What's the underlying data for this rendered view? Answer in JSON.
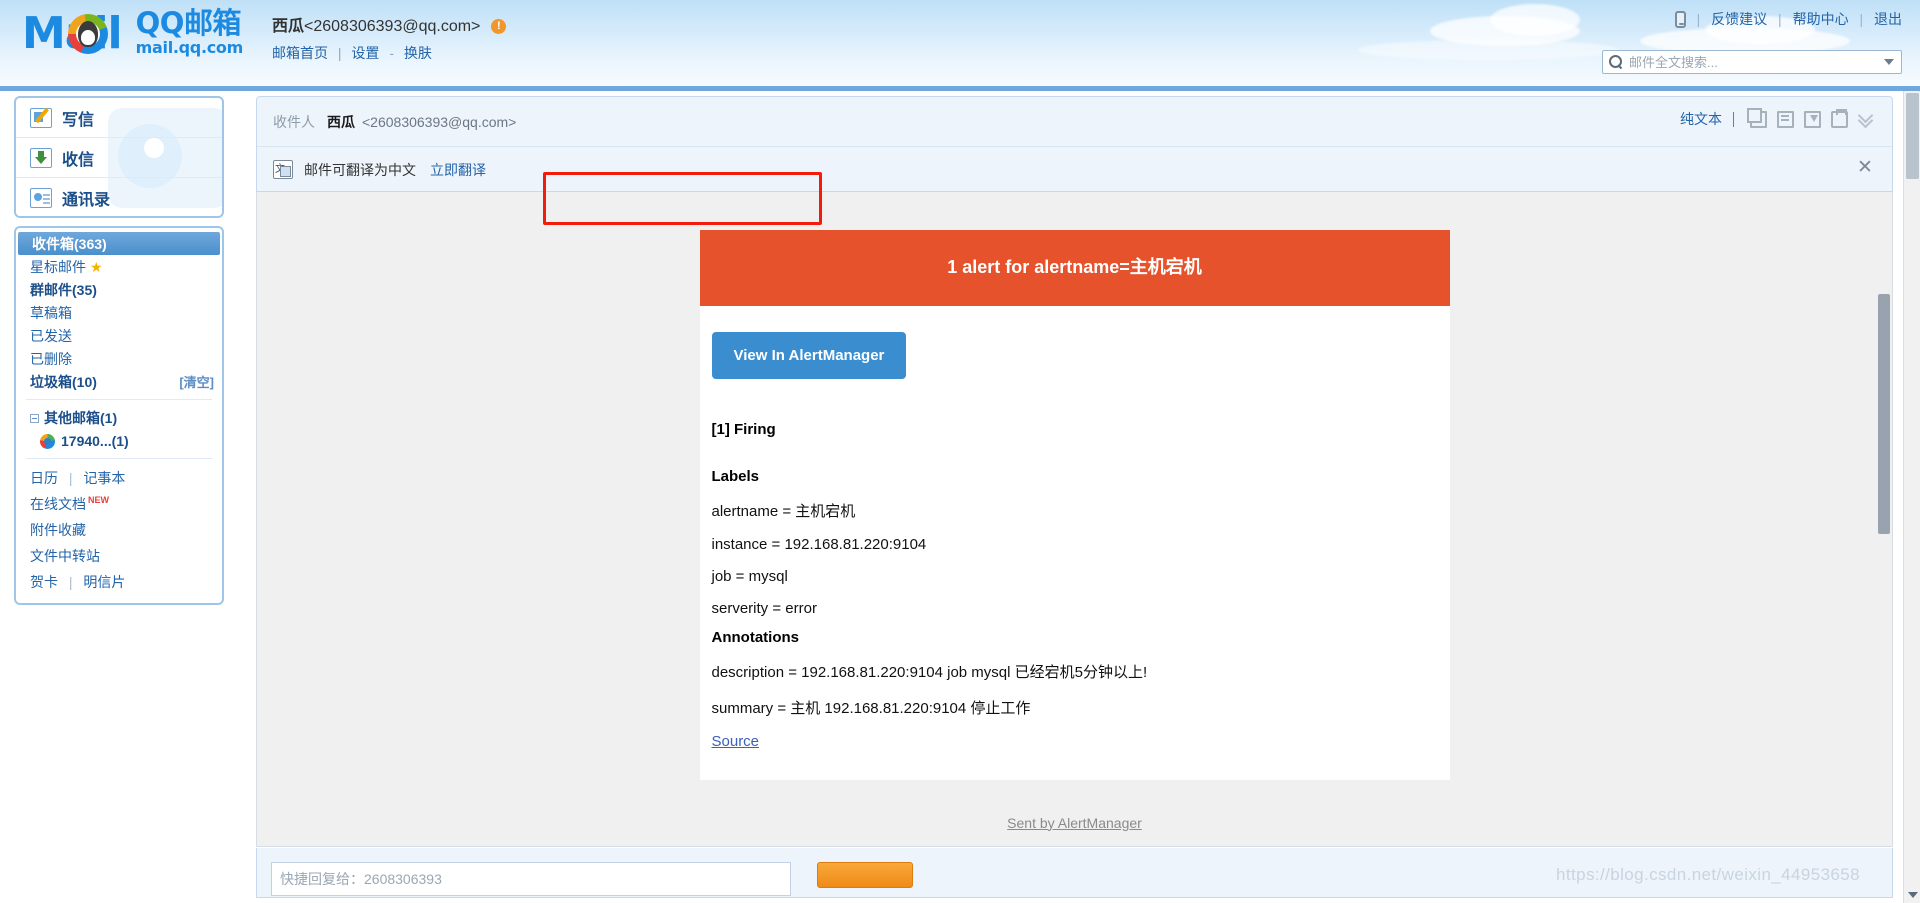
{
  "header": {
    "logo": {
      "mail_text": "Mail",
      "brand_cn": "QQ邮箱",
      "brand_url": "mail.qq.com"
    },
    "account": {
      "name": "西瓜",
      "email": "<2608306393@qq.com>",
      "warning_glyph": "!"
    },
    "account_links": [
      {
        "label": "邮箱首页",
        "name": "mailbox-home-link"
      },
      {
        "label": "设置",
        "name": "settings-link"
      },
      {
        "label": "换肤",
        "name": "skin-link"
      }
    ],
    "top_links": [
      {
        "label": "反馈建议",
        "name": "feedback-link"
      },
      {
        "label": "帮助中心",
        "name": "help-center-link"
      },
      {
        "label": "退出",
        "name": "logout-link"
      }
    ],
    "search": {
      "placeholder": "邮件全文搜索...",
      "value": ""
    }
  },
  "sidebar": {
    "actions": [
      {
        "label": "写信",
        "icon": "compose-icon"
      },
      {
        "label": "收信",
        "icon": "receive-icon"
      },
      {
        "label": "通讯录",
        "icon": "contacts-icon"
      }
    ],
    "folders": [
      {
        "label": "收件箱(363)",
        "selected": true,
        "bold": true
      },
      {
        "label": "星标邮件",
        "star": "★"
      },
      {
        "label": "群邮件(35)",
        "bold": true
      },
      {
        "label": "草稿箱"
      },
      {
        "label": "已发送"
      },
      {
        "label": "已删除"
      },
      {
        "label": "垃圾箱(10)",
        "bold": true,
        "action": "[清空]"
      }
    ],
    "other_mailboxes": {
      "label": "其他邮箱(1)",
      "item": "17940...(1)"
    },
    "links": [
      {
        "parts": [
          "日历",
          "记事本"
        ]
      },
      {
        "parts": [
          "在线文档"
        ],
        "badge": "NEW"
      },
      {
        "parts": [
          "附件收藏"
        ]
      },
      {
        "parts": [
          "文件中转站"
        ]
      },
      {
        "parts": [
          "贺卡",
          "明信片"
        ]
      }
    ]
  },
  "mail": {
    "recipient_label": "收件人",
    "recipient_name": "西瓜",
    "recipient_addr": "<2608306393@qq.com>",
    "toolbar": {
      "plain_text": "纯文本",
      "icons": [
        "new-window-icon",
        "document-icon",
        "save-icon",
        "print-icon",
        "more-chevron-icon"
      ]
    },
    "translate": {
      "text": "邮件可翻译为中文",
      "link": "立即翻译",
      "close": "✕"
    },
    "reply": {
      "placeholder": "快捷回复给：2608306393"
    }
  },
  "alert": {
    "header": "1 alert for alertname=主机宕机",
    "button": "View In AlertManager",
    "firing": "[1] Firing",
    "labels_title": "Labels",
    "labels": [
      "alertname = 主机宕机",
      "instance = 192.168.81.220:9104",
      "job = mysql",
      "serverity = error"
    ],
    "annotations_title": "Annotations",
    "annotations": [
      "description = 192.168.81.220:9104 job mysql 已经宕机5分钟以上!",
      "summary = 主机 192.168.81.220:9104 停止工作"
    ],
    "source_link": "Source",
    "footer_link": "Sent by AlertManager",
    "colors": {
      "header_bg": "#e6522c",
      "button_bg": "#3a8ed0",
      "link": "#3a60c0"
    }
  },
  "watermark": "https://blog.csdn.net/weixin_44953658"
}
